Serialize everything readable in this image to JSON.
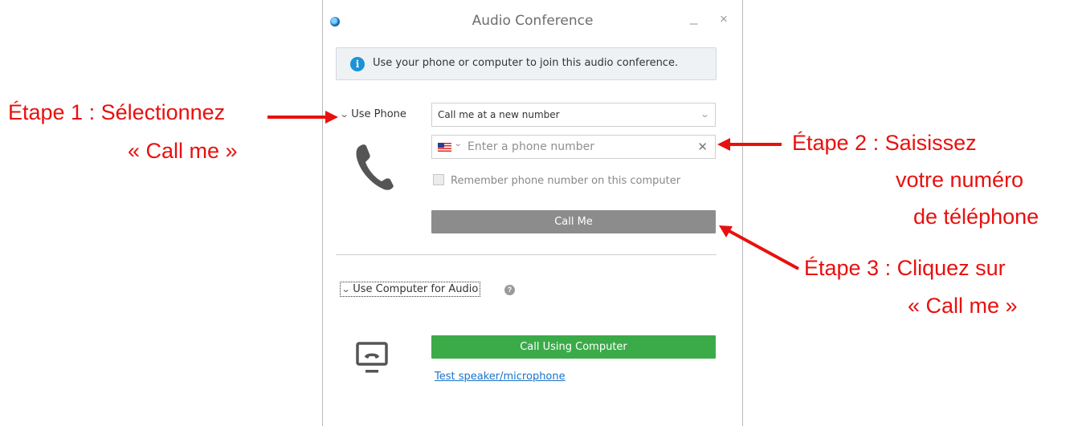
{
  "window": {
    "title": "Audio Conference",
    "minimize_glyph": "_",
    "close_glyph": "×"
  },
  "info_banner": {
    "icon": "info-icon",
    "icon_glyph": "i",
    "text": "Use your phone or computer to join this audio conference."
  },
  "phone_section": {
    "toggle_label": "Use Phone",
    "select_value": "Call me at a new number",
    "phone_placeholder": "Enter a phone number",
    "flag": "us-flag-icon",
    "clear_glyph": "✕",
    "remember_label": "Remember phone number on this computer",
    "call_button": "Call Me"
  },
  "computer_section": {
    "toggle_label": "Use Computer for Audio",
    "help_glyph": "?",
    "call_button": "Call Using Computer",
    "test_link": "Test speaker/microphone"
  },
  "annotations": {
    "step1_line1": "Étape 1 : Sélectionnez",
    "step1_line2": "« Call me »",
    "step2_line1": "Étape 2 : Saisissez",
    "step2_line2": "votre numéro",
    "step2_line3": "de téléphone",
    "step3_line1": "Étape 3 : Cliquez sur",
    "step3_line2": "« Call me »"
  },
  "colors": {
    "annotation_red": "#e8100e",
    "call_me_gray": "#8c8c8c",
    "computer_green": "#3bab49",
    "link_blue": "#1a73c9",
    "info_blue": "#1b93d6"
  }
}
